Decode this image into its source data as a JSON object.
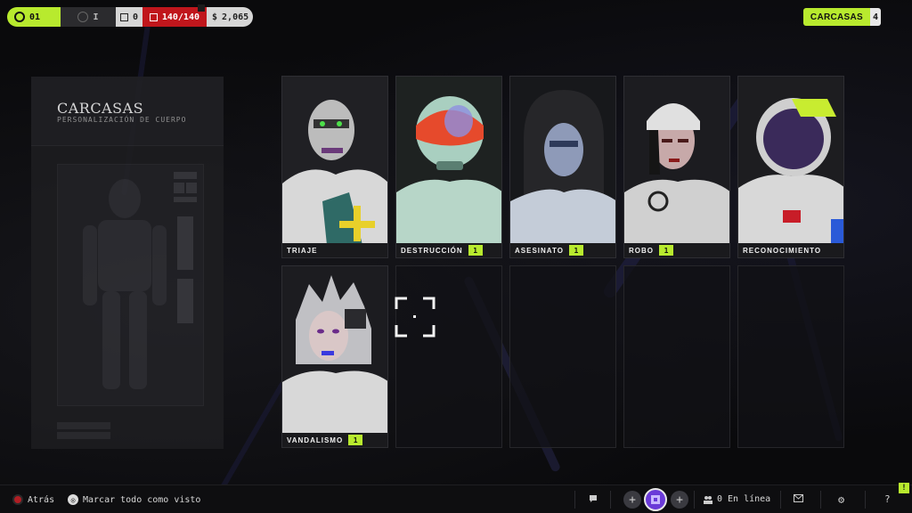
{
  "topbar": {
    "level": "01",
    "rank": "I",
    "cards": "0",
    "health": "140/140",
    "money": "2,065"
  },
  "collection": {
    "title": "CARCASAS",
    "count": "4"
  },
  "panel": {
    "title": "CARCASAS",
    "subtitle": "PERSONALIZACIÓN DE CUERPO"
  },
  "cards": [
    {
      "label": "TRIAJE",
      "badge": ""
    },
    {
      "label": "DESTRUCCIÓN",
      "badge": "1"
    },
    {
      "label": "ASESINATO",
      "badge": "1"
    },
    {
      "label": "ROBO",
      "badge": "1"
    },
    {
      "label": "RECONOCIMIENTO",
      "badge": ""
    },
    {
      "label": "VANDALISMO",
      "badge": "1"
    }
  ],
  "bottombar": {
    "back": "Atrás",
    "mark_all": "Marcar todo como visto",
    "online": "0 En línea",
    "help": "?"
  },
  "alert": "!",
  "colors": {
    "accent": "#b8ea2e",
    "health": "#c0161c",
    "avatar": "#6a3ad8"
  },
  "icons": [
    "skull-icon",
    "rank-icon",
    "card-icon",
    "health-icon",
    "money-icon",
    "chat-icon",
    "plus-icon",
    "friends-icon",
    "mail-icon",
    "gear-icon",
    "help-icon"
  ]
}
